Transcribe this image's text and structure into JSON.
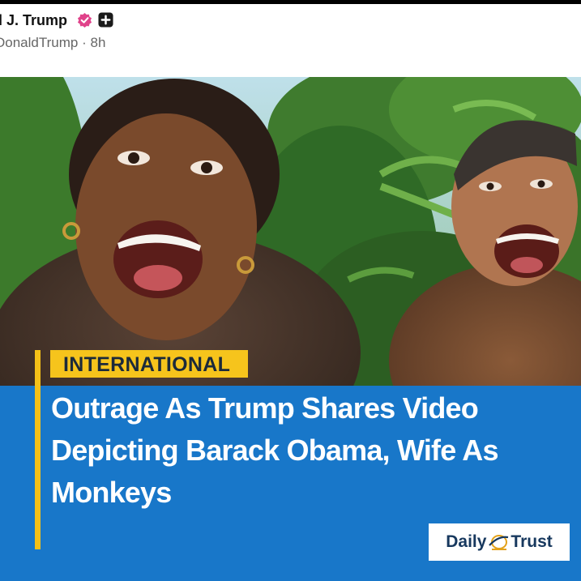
{
  "post": {
    "author_name": "l J. Trump",
    "handle": "DonaldTrump",
    "separator": "·",
    "time_ago": "8h",
    "icons": [
      "verified-badge-icon",
      "plus-icon"
    ]
  },
  "card": {
    "category": "INTERNATIONAL",
    "headline": "Outrage As Trump Shares Video Depicting Barack Obama, Wife As Monkeys",
    "brand_left": "Daily",
    "brand_right": "Trust",
    "colors": {
      "panel": "#1877c9",
      "accent": "#f4c017",
      "badge": "#f6c41c",
      "verified": "#e0428a"
    }
  }
}
